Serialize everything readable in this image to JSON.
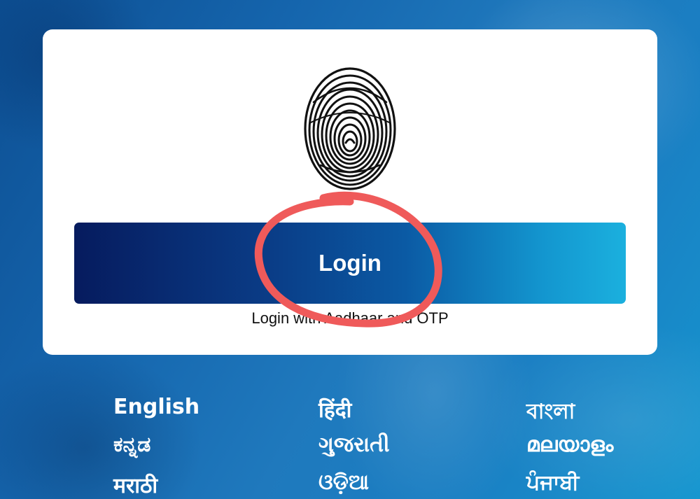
{
  "login_card": {
    "fingerprint_icon": "fingerprint-icon",
    "login_button_label": "Login",
    "subtext": "Login with Aadhaar and OTP"
  },
  "languages": [
    "English",
    "हिंदी",
    "বাংলা",
    "ಕನ್ನಡ",
    "ગુજરાતી",
    "മലയാളം",
    "मराठी",
    "ଓଡ଼ିଆ",
    "ਪੰਜਾਬੀ"
  ],
  "colors": {
    "background": "#1565ad",
    "card": "#ffffff",
    "button_gradient_start": "#061b5e",
    "button_gradient_end": "#1bb0de",
    "annotation": "#ef5a5a",
    "language_text": "#ffffff"
  }
}
